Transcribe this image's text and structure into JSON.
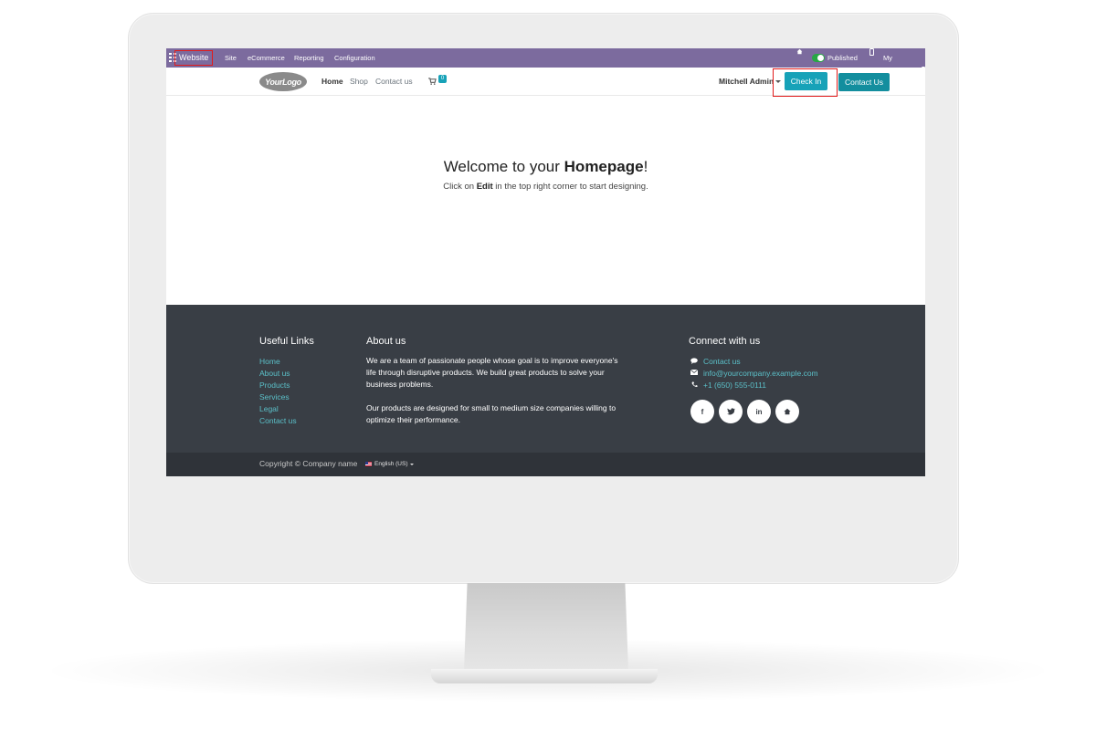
{
  "topbar": {
    "app_name": "Website",
    "menu": [
      "Site",
      "eCommerce",
      "Reporting",
      "Configuration"
    ],
    "published_label": "Published",
    "my_website_label": "My Website"
  },
  "navbar": {
    "logo_text": "YourLogo",
    "links": [
      "Home",
      "Shop",
      "Contact us"
    ],
    "cart_count": "0",
    "user_name": "Mitchell Admin",
    "checkin_label": "Check In",
    "contact_label": "Contact Us"
  },
  "hero": {
    "title_prefix": "Welcome to your ",
    "title_bold": "Homepage",
    "title_suffix": "!",
    "sub_prefix": "Click on ",
    "sub_bold": "Edit",
    "sub_suffix": " in the top right corner to start designing."
  },
  "footer": {
    "useful_links_title": "Useful Links",
    "useful_links": [
      "Home",
      "About us",
      "Products",
      "Services",
      "Legal",
      "Contact us"
    ],
    "about_title": "About us",
    "about_p1_lines": [
      "We are a team of passionate people whose goal is to improve everyone's",
      "life through disruptive products. We build great products to solve your",
      "business problems."
    ],
    "about_p2_lines": [
      "Our products are designed for small to medium size companies willing to",
      "optimize their performance."
    ],
    "connect_title": "Connect with us",
    "contact_link": "Contact us",
    "email": "info@yourcompany.example.com",
    "phone": "+1 (650) 555-0111",
    "social": [
      "f",
      "t",
      "in",
      "home"
    ],
    "copyright": "Copyright © Company name",
    "language": "English (US)"
  },
  "colors": {
    "topbar": "#7c6b9e",
    "accent": "#17a2b8",
    "footer": "#393e45",
    "highlight": "#e21b1b"
  }
}
